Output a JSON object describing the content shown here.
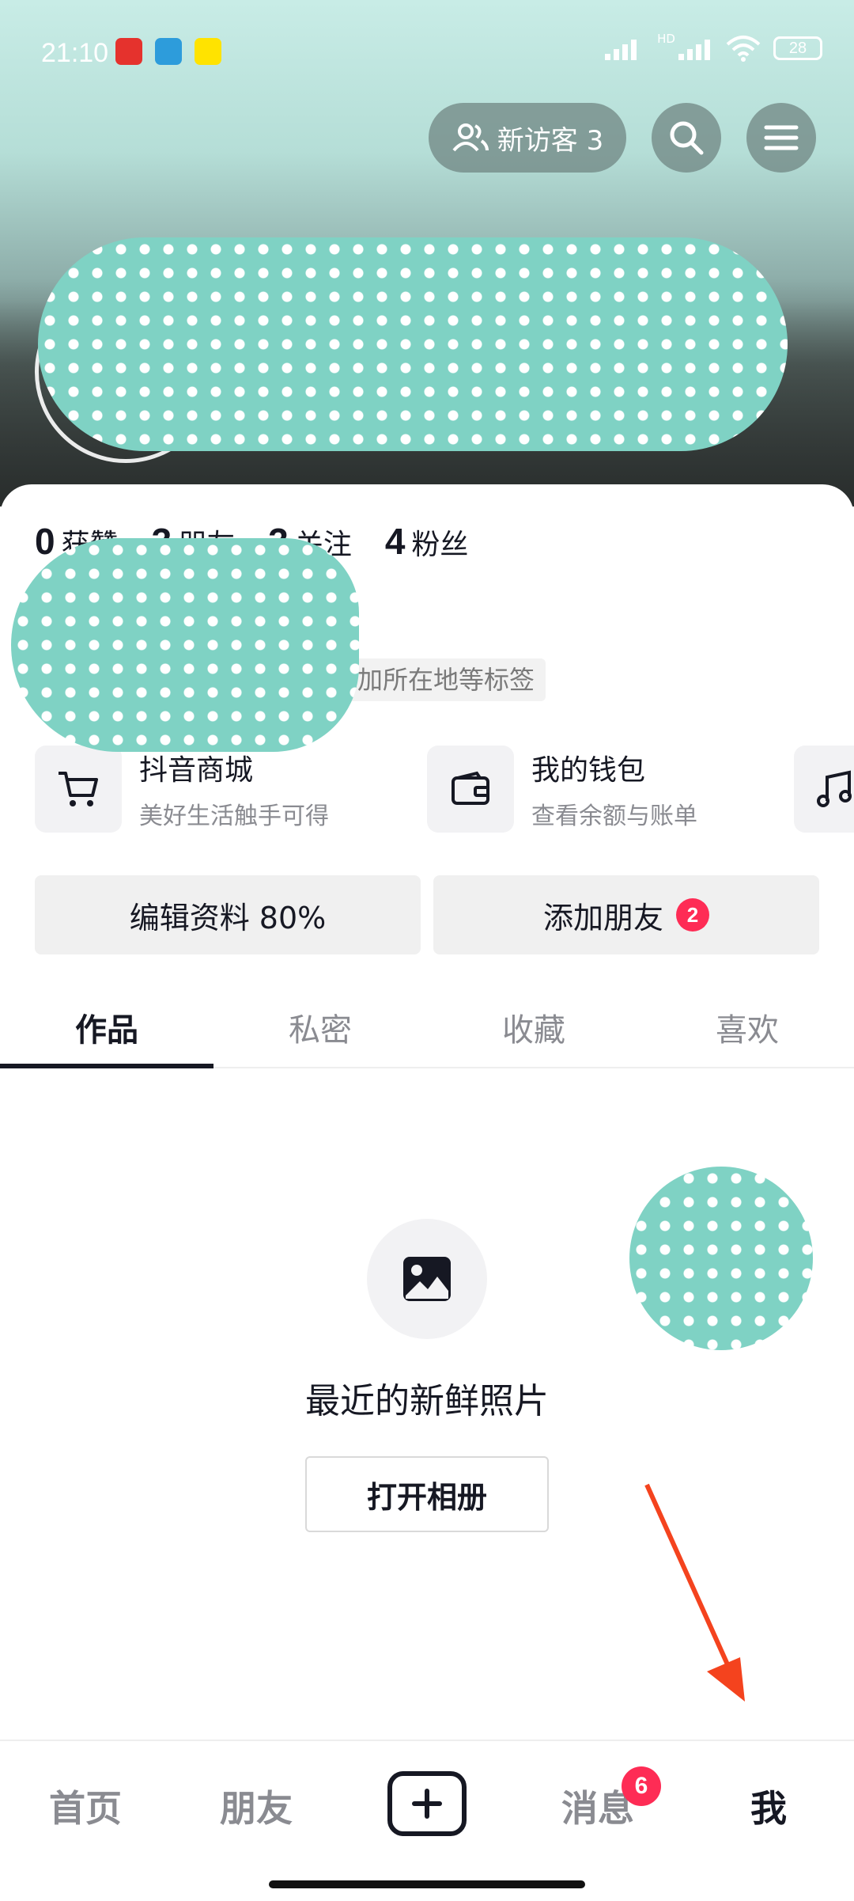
{
  "status_bar": {
    "time": "21:10",
    "battery": "28",
    "network_label": "HD"
  },
  "header": {
    "visitor_button": {
      "label": "新访客 3",
      "icon": "people-icon"
    },
    "search_icon": "search-icon",
    "menu_icon": "hamburger-menu-icon"
  },
  "profile": {
    "stats": [
      {
        "count": "0",
        "label": "获赞"
      },
      {
        "count": "3",
        "label": "朋友"
      },
      {
        "count": "3",
        "label": "关注"
      },
      {
        "count": "4",
        "label": "粉丝"
      }
    ],
    "tag_prompt": "添加所在地等标签"
  },
  "services": [
    {
      "title": "抖音商城",
      "subtitle": "美好生活触手可得",
      "icon": "cart-icon"
    },
    {
      "title": "我的钱包",
      "subtitle": "查看余额与账单",
      "icon": "wallet-icon"
    },
    {
      "title": "",
      "subtitle": "",
      "icon": "music-note-icon"
    }
  ],
  "actions": {
    "edit_profile": "编辑资料 80%",
    "add_friend": "添加朋友",
    "add_friend_badge": "2"
  },
  "tabs": [
    {
      "label": "作品",
      "active": true
    },
    {
      "label": "私密",
      "active": false
    },
    {
      "label": "收藏",
      "active": false
    },
    {
      "label": "喜欢",
      "active": false
    }
  ],
  "empty_state": {
    "icon": "image-icon",
    "title": "最近的新鲜照片",
    "button": "打开相册"
  },
  "bottom_nav": {
    "items": [
      {
        "label": "首页",
        "active": false
      },
      {
        "label": "朋友",
        "active": false
      },
      {
        "label": "消息",
        "active": false,
        "badge": "6"
      },
      {
        "label": "我",
        "active": true
      }
    ],
    "create_icon": "plus-icon"
  },
  "colors": {
    "accent_red": "#fe2c55",
    "text_primary": "#161823",
    "text_secondary": "#8a8b91",
    "annotation_arrow": "#f4431e"
  }
}
